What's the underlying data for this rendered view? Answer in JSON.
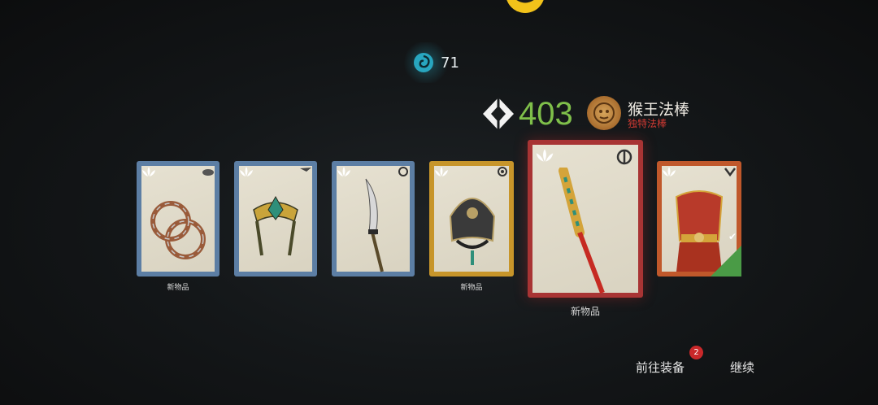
{
  "currency": {
    "icon": "spiral-currency-icon",
    "value": "71"
  },
  "item": {
    "gear_score": "403",
    "name": "猴王法棒",
    "type": "独特法棒",
    "rarity_color": "#b8792f"
  },
  "cards": [
    {
      "id": "rings",
      "rarity": "rare",
      "label": "新物品",
      "icon": "ring-icon"
    },
    {
      "id": "crown",
      "rarity": "rare",
      "label": "",
      "icon": "crown-icon"
    },
    {
      "id": "blade",
      "rarity": "rare",
      "label": "",
      "icon": "blade-icon"
    },
    {
      "id": "helmet",
      "rarity": "epic",
      "label": "新物品",
      "icon": "helmet-icon"
    },
    {
      "id": "staff",
      "rarity": "unique",
      "label": "新物品",
      "icon": "staff-icon"
    },
    {
      "id": "armor",
      "rarity": "legendary",
      "label": "",
      "icon": "armor-icon",
      "equipped": true
    }
  ],
  "buttons": {
    "equip_label": "前往装备",
    "equip_badge": "2",
    "continue_label": "继续"
  },
  "colors": {
    "rare": "#5c7ea4",
    "epic": "#c7952a",
    "unique": "#a83434",
    "legendary": "#c0582b",
    "gear_score": "#7fbf4a"
  }
}
